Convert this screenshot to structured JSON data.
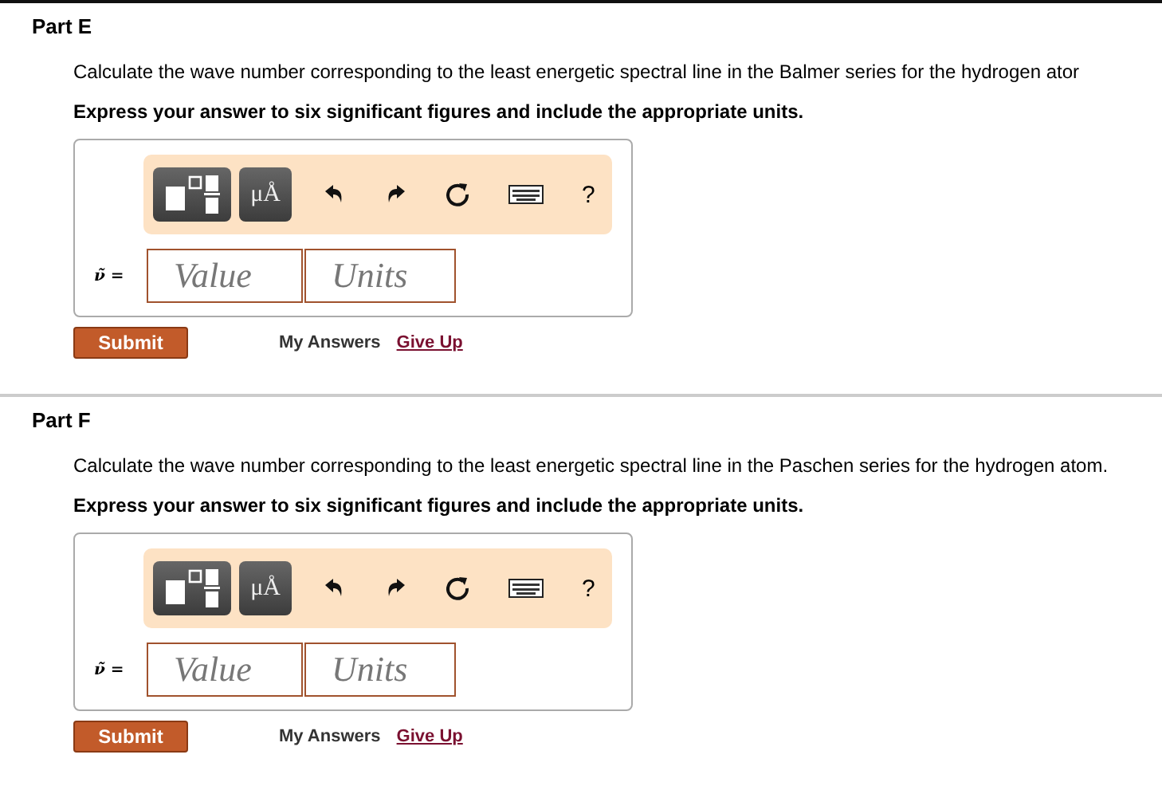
{
  "parts": [
    {
      "title": "Part E",
      "question": "Calculate the wave number corresponding to the least energetic spectral line in the Balmer series for the hydrogen ator",
      "instruction": "Express your answer to six significant figures and include the appropriate units.",
      "toolbar": {
        "units_button": "μÅ",
        "help": "?"
      },
      "answer_label": "ν̃ =",
      "value_placeholder": "Value",
      "units_placeholder": "Units",
      "submit": "Submit",
      "my_answers": "My Answers",
      "give_up": "Give Up"
    },
    {
      "title": "Part F",
      "question": "Calculate the wave number corresponding to the least energetic spectral line in the Paschen series for the hydrogen atom.",
      "instruction": "Express your answer to six significant figures and include the appropriate units.",
      "toolbar": {
        "units_button": "μÅ",
        "help": "?"
      },
      "answer_label": "ν̃ =",
      "value_placeholder": "Value",
      "units_placeholder": "Units",
      "submit": "Submit",
      "my_answers": "My Answers",
      "give_up": "Give Up"
    }
  ]
}
